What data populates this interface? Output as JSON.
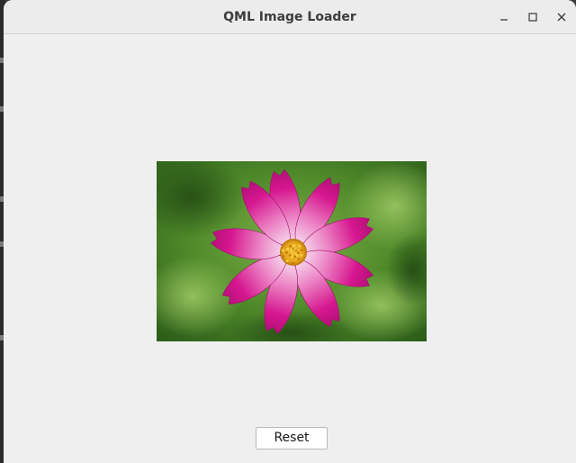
{
  "window": {
    "title": "QML Image Loader"
  },
  "controls": {
    "minimize_icon": "minimize-icon",
    "maximize_icon": "maximize-icon",
    "close_icon": "close-icon"
  },
  "image": {
    "subject": "pink-flower-photo",
    "colors": {
      "petal": "#d6178f",
      "petal_light": "#f6d6ec",
      "center": "#e8a51c",
      "background": "#4f8a2a"
    }
  },
  "footer": {
    "reset_label": "Reset"
  }
}
